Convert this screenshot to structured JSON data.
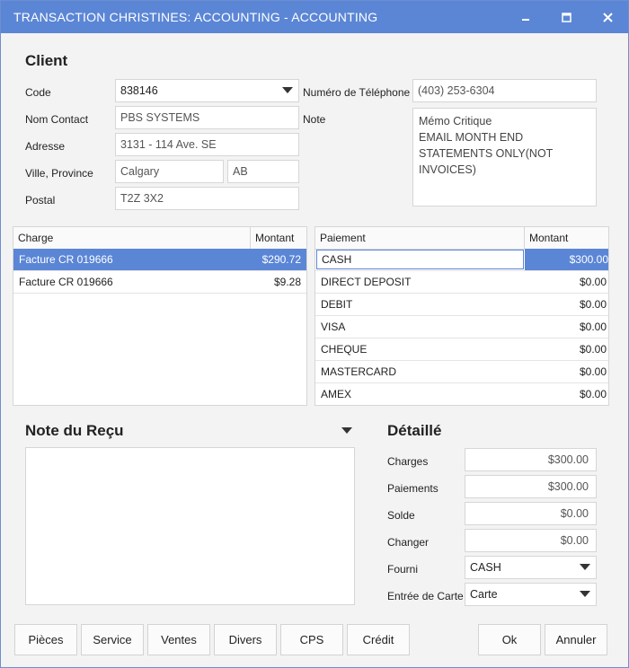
{
  "window": {
    "title": "TRANSACTION CHRISTINES: ACCOUNTING - ACCOUNTING",
    "minimize_icon": "minimize-icon",
    "maximize_icon": "maximize-icon",
    "close_icon": "close-icon"
  },
  "client": {
    "section_title": "Client",
    "code_label": "Code",
    "code_value": "838146",
    "contact_label": "Nom Contact",
    "contact_value": "PBS SYSTEMS",
    "address_label": "Adresse",
    "address_value": "3131 - 114 Ave. SE",
    "city_label": "Ville, Province",
    "city_value": "Calgary",
    "province_value": "AB",
    "postal_label": "Postal",
    "postal_value": "T2Z 3X2",
    "phone_label": "Numéro de Téléphone",
    "phone_value": "(403) 253-6304",
    "note_label": "Note",
    "note_value": "Mémo Critique\nEMAIL MONTH END STATEMENTS ONLY(NOT INVOICES)"
  },
  "charges": {
    "col_charge": "Charge",
    "col_amount": "Montant",
    "rows": [
      {
        "charge": "Facture CR 019666",
        "amount": "$290.72"
      },
      {
        "charge": "Facture CR 019666",
        "amount": "$9.28"
      }
    ]
  },
  "payments": {
    "col_payment": "Paiement",
    "col_amount": "Montant",
    "rows": [
      {
        "payment": "CASH",
        "amount": "$300.00"
      },
      {
        "payment": "DIRECT DEPOSIT",
        "amount": "$0.00"
      },
      {
        "payment": "DEBIT",
        "amount": "$0.00"
      },
      {
        "payment": "VISA",
        "amount": "$0.00"
      },
      {
        "payment": "CHEQUE",
        "amount": "$0.00"
      },
      {
        "payment": "MASTERCARD",
        "amount": "$0.00"
      },
      {
        "payment": "AMEX",
        "amount": "$0.00"
      }
    ]
  },
  "receipt_note": {
    "title": "Note du Reçu",
    "value": ""
  },
  "detail": {
    "title": "Détaillé",
    "charges_label": "Charges",
    "charges_value": "$300.00",
    "payments_label": "Paiements",
    "payments_value": "$300.00",
    "balance_label": "Solde",
    "balance_value": "$0.00",
    "change_label": "Changer",
    "change_value": "$0.00",
    "provided_label": "Fourni",
    "provided_value": "CASH",
    "card_entry_label": "Entrée de Carte",
    "card_entry_value": "Carte"
  },
  "buttons": {
    "parts": "Pièces",
    "service": "Service",
    "sales": "Ventes",
    "misc": "Divers",
    "cps": "CPS",
    "credit": "Crédit",
    "ok": "Ok",
    "cancel": "Annuler"
  }
}
